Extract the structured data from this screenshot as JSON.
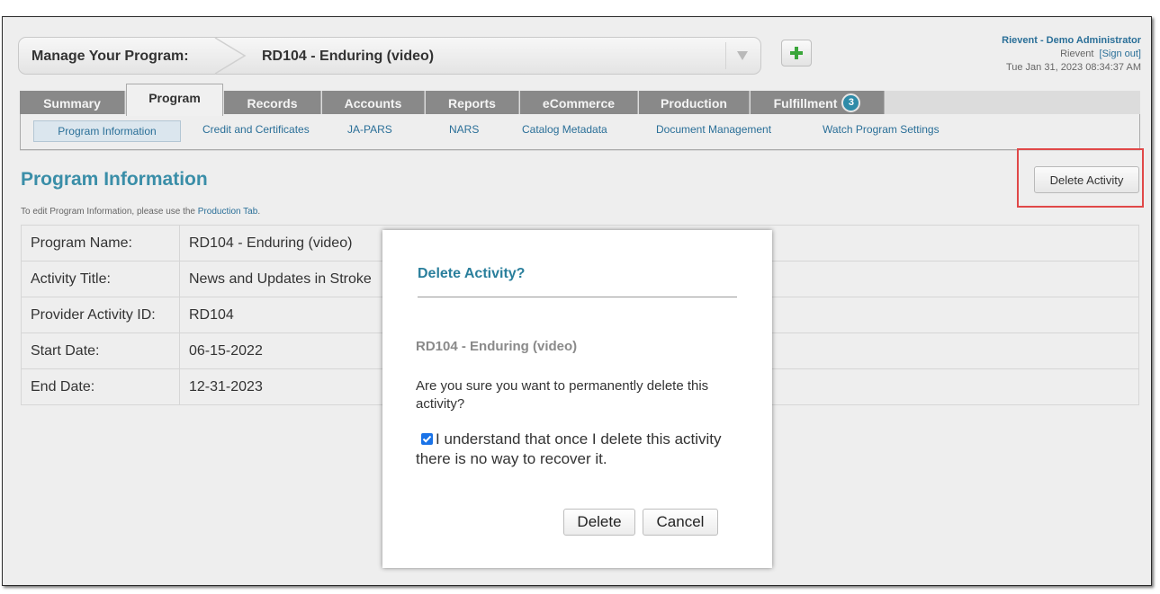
{
  "header": {
    "selector_label": "Manage Your Program:",
    "selector_value": "RD104 - Enduring (video)",
    "user_name": "Rievent - Demo Administrator",
    "org_name": "Rievent",
    "sign_out": "[Sign out]",
    "timestamp": "Tue Jan 31, 2023 08:34:37 AM"
  },
  "tabs": [
    {
      "label": "Summary"
    },
    {
      "label": "Program"
    },
    {
      "label": "Records"
    },
    {
      "label": "Accounts"
    },
    {
      "label": "Reports"
    },
    {
      "label": "eCommerce"
    },
    {
      "label": "Production"
    },
    {
      "label": "Fulfillment",
      "badge": "3"
    }
  ],
  "subnav": [
    {
      "label": "Program Information"
    },
    {
      "label": "Credit and Certificates"
    },
    {
      "label": "JA-PARS"
    },
    {
      "label": "NARS"
    },
    {
      "label": "Catalog Metadata"
    },
    {
      "label": "Document Management"
    },
    {
      "label": "Watch Program Settings"
    }
  ],
  "page": {
    "heading": "Program Information",
    "delete_button": "Delete Activity",
    "hint_prefix": "To edit Program Information, please use the",
    "hint_link": "Production Tab",
    "hint_suffix": "."
  },
  "info_rows": [
    {
      "label": "Program Name:",
      "value": "RD104 - Enduring (video)"
    },
    {
      "label": "Activity Title:",
      "value": "News and Updates in Stroke"
    },
    {
      "label": "Provider Activity ID:",
      "value": "RD104"
    },
    {
      "label": "Start Date:",
      "value": "06-15-2022"
    },
    {
      "label": "End Date:",
      "value": "12-31-2023"
    }
  ],
  "modal": {
    "title": "Delete Activity?",
    "activity": "RD104 - Enduring (video)",
    "question": "Are you sure you want to permanently delete this activity?",
    "confirm_text": "I understand that once I delete this activity there is no way to recover it.",
    "confirm_checked": true,
    "delete_label": "Delete",
    "cancel_label": "Cancel"
  },
  "colors": {
    "accent": "#3a8ea8",
    "link": "#2a6f98",
    "highlight": "#e04848",
    "tab_bg": "#898989",
    "add_icon": "#3aa63a"
  },
  "icons": [
    "chevron-down-icon",
    "plus-icon",
    "checkbox-checked-icon"
  ]
}
